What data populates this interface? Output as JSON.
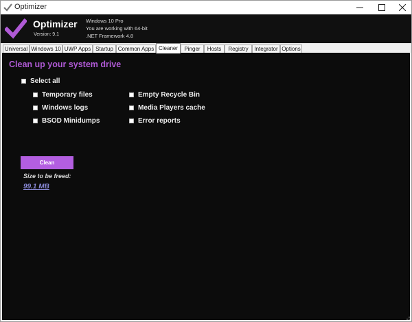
{
  "window": {
    "title": "Optimizer",
    "controls": {
      "minimize": "minimize-icon",
      "maximize": "maximize-icon",
      "close": "close-icon"
    }
  },
  "header": {
    "app_name": "Optimizer",
    "version": "Version: 9.1",
    "os": "Windows 10 Pro",
    "arch": "You are working with 64-bit",
    "framework": ".NET Framework 4.8"
  },
  "tabs": [
    {
      "label": "Universal"
    },
    {
      "label": "Windows 10"
    },
    {
      "label": "UWP Apps"
    },
    {
      "label": "Startup"
    },
    {
      "label": "Common Apps"
    },
    {
      "label": "Cleaner",
      "active": true
    },
    {
      "label": "Pinger"
    },
    {
      "label": "Hosts"
    },
    {
      "label": "Registry"
    },
    {
      "label": "Integrator"
    },
    {
      "label": "Options"
    }
  ],
  "cleaner": {
    "title": "Clean up your system drive",
    "select_all": "Select all",
    "left_items": [
      "Temporary files",
      "Windows logs",
      "BSOD Minidumps"
    ],
    "right_items": [
      "Empty Recycle Bin",
      "Media Players cache",
      "Error reports"
    ],
    "clean_button": "Clean",
    "size_label": "Size to be freed:",
    "size_value": "99.1 MB"
  },
  "colors": {
    "accent": "#b05ad6",
    "button": "#b35ee0",
    "background": "#0c0c0c",
    "header": "#101010",
    "link": "#8a8ad8"
  }
}
